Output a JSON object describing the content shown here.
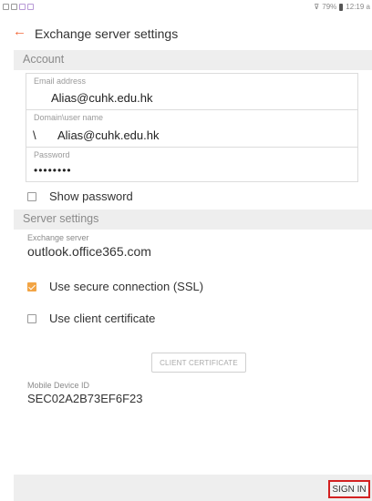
{
  "status_bar": {
    "left_icons": [
      "sd-card-icon",
      "silent-icon",
      "mail-icon",
      "mail-icon"
    ],
    "battery": "79%",
    "time": "12:19 a"
  },
  "app_bar": {
    "title": "Exchange server settings"
  },
  "account": {
    "header": "Account",
    "email_label": "Email address",
    "email_value": "Alias@cuhk.edu.hk",
    "domain_label": "Domain\\user name",
    "domain_prefix": "\\",
    "domain_value": "Alias@cuhk.edu.hk",
    "password_label": "Password",
    "password_value": "••••••••",
    "show_password_label": "Show password",
    "show_password_checked": false
  },
  "server": {
    "header": "Server settings",
    "exchange_label": "Exchange server",
    "exchange_value": "outlook.office365.com",
    "ssl_label": "Use secure connection (SSL)",
    "ssl_checked": true,
    "client_cert_label": "Use client certificate",
    "client_cert_checked": false,
    "client_cert_button": "CLIENT CERTIFICATE"
  },
  "device": {
    "label": "Mobile Device ID",
    "value": "SEC02A2B73EF6F23"
  },
  "footer": {
    "sign_in": "SIGN IN"
  },
  "colors": {
    "accent": "#f2683a",
    "checkbox_checked": "#f2a444",
    "highlight_border": "#d32020"
  }
}
